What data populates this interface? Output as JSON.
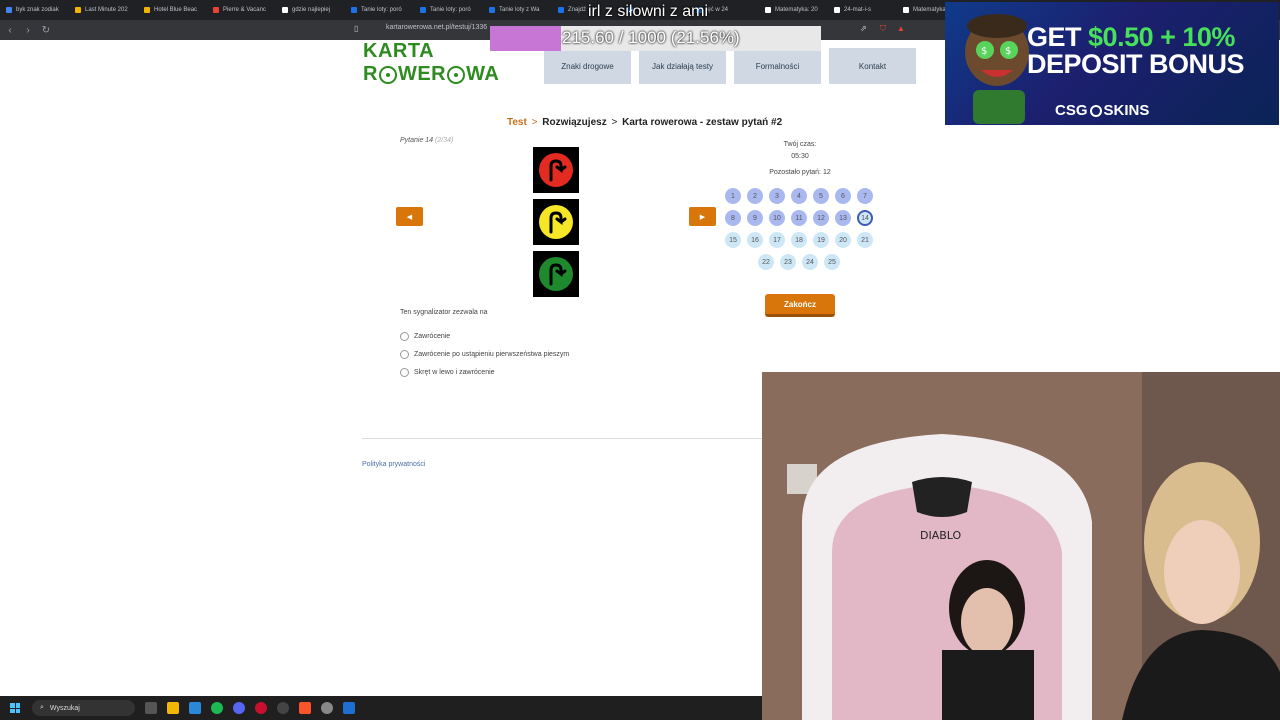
{
  "browser": {
    "tabs": [
      {
        "label": "byk znak zodiak",
        "color": "#4285f4"
      },
      {
        "label": "Last Minute 202",
        "color": "#f4b400"
      },
      {
        "label": "Hotel Blue Beac",
        "color": "#f4b400"
      },
      {
        "label": "Pierre & Vacanc",
        "color": "#ea4335"
      },
      {
        "label": "gdzie najlepiej",
        "color": "#ffffff"
      },
      {
        "label": "Tanie loty: poró",
        "color": "#1a73e8"
      },
      {
        "label": "Tanie loty: poró",
        "color": "#1a73e8"
      },
      {
        "label": "Tanie loty z Wa",
        "color": "#1a73e8"
      },
      {
        "label": "Znajdź",
        "color": "#1a73e8"
      },
      {
        "label": "",
        "color": "#1a73e8"
      },
      {
        "label": "jęć w 24",
        "color": "#1a73e8"
      },
      {
        "label": "Matematyka: 20",
        "color": "#ffffff"
      },
      {
        "label": "24-mat-i-s",
        "color": "#ffffff"
      },
      {
        "label": "Matematyka: 20",
        "color": "#ffffff"
      },
      {
        "label": "Matematyk",
        "color": "#ffffff"
      }
    ],
    "url": "kartarowerowa.net.pl/testuj/1336"
  },
  "overlay": {
    "title": "irl z siłowni z ami",
    "goal_text": "215.60 / 1000 (21.56%)",
    "goal_fraction": 0.2156
  },
  "ad": {
    "line1_prefix": "GET",
    "line1_amount": "$0.50 + 10%",
    "line2": "DEPOSIT BONUS",
    "brand_left": "CSG",
    "brand_right": "SKINS"
  },
  "site": {
    "logo_top": "KARTA",
    "logo_bottom_a": "R",
    "logo_bottom_b": "WER",
    "logo_bottom_c": "WA",
    "nav": [
      "Znaki drogowe",
      "Jak działają testy",
      "Formalności",
      "Kontakt"
    ]
  },
  "breadcrumb": {
    "root": "Test",
    "sep": ">",
    "middle": "Rozwiązujesz",
    "current": "Karta rowerowa - zestaw pytań #2"
  },
  "question": {
    "number_label": "Pytanie 14",
    "number_total": "(2/34)",
    "text": "Ten sygnalizator zezwala na",
    "answers": [
      "Zawrócenie",
      "Zawrócenie po ustąpieniu pierwszeństwa pieszym",
      "Skręt w lewo i zawrócenie"
    ],
    "signals": [
      {
        "color": "#e32b22"
      },
      {
        "color": "#f5e628"
      },
      {
        "color": "#1e8a2d"
      }
    ]
  },
  "timer": {
    "label": "Twój czas:",
    "value": "05:30",
    "remaining": "Pozostało pytań: 12"
  },
  "questions_grid": [
    {
      "n": "1",
      "state": "seen"
    },
    {
      "n": "2",
      "state": "seen"
    },
    {
      "n": "3",
      "state": "seen"
    },
    {
      "n": "4",
      "state": "seen"
    },
    {
      "n": "5",
      "state": "seen"
    },
    {
      "n": "6",
      "state": "seen"
    },
    {
      "n": "7",
      "state": "seen"
    },
    {
      "n": "8",
      "state": "seen"
    },
    {
      "n": "9",
      "state": "seen"
    },
    {
      "n": "10",
      "state": "seen"
    },
    {
      "n": "11",
      "state": "seen"
    },
    {
      "n": "12",
      "state": "seen"
    },
    {
      "n": "13",
      "state": "seen"
    },
    {
      "n": "14",
      "state": "current"
    },
    {
      "n": "15",
      "state": "todo"
    },
    {
      "n": "16",
      "state": "todo"
    },
    {
      "n": "17",
      "state": "todo"
    },
    {
      "n": "18",
      "state": "todo"
    },
    {
      "n": "19",
      "state": "todo"
    },
    {
      "n": "20",
      "state": "todo"
    },
    {
      "n": "21",
      "state": "todo"
    },
    {
      "n": "22",
      "state": "todo"
    },
    {
      "n": "23",
      "state": "todo"
    },
    {
      "n": "24",
      "state": "todo"
    },
    {
      "n": "25",
      "state": "todo"
    }
  ],
  "finish_label": "Zakończ",
  "prev_glyph": "◀",
  "next_glyph": "▶",
  "footer": {
    "privacy": "Polityka prywatności"
  },
  "taskbar": {
    "search_placeholder": "Wyszukaj"
  }
}
